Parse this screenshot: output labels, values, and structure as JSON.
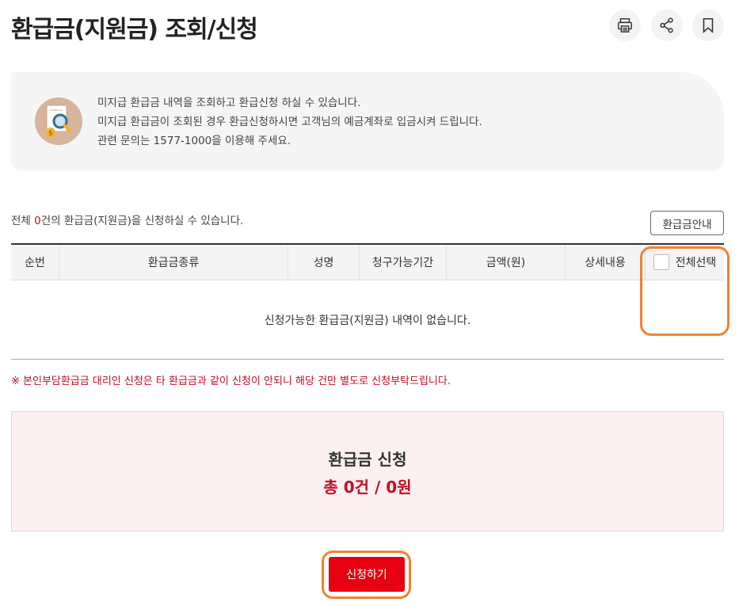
{
  "page": {
    "title": "환급금(지원금) 조회/신청"
  },
  "toolbar": {
    "print_icon": "print-icon",
    "share_icon": "share-icon",
    "bookmark_icon": "bookmark-icon"
  },
  "info": {
    "icon": "document-search-icon",
    "lines": [
      "미지급 환급금 내역을 조회하고 환급신청 하실 수 있습니다.",
      "미지급 환급금이 조회된 경우 환급신청하시면 고객님의 예금계좌로 입금시켜 드립니다.",
      "관련 문의는 1577-1000을 이용해 주세요."
    ]
  },
  "summary": {
    "prefix": "전체 ",
    "count": "0",
    "suffix": "건의 환급금(지원금)을 신청하실 수 있습니다."
  },
  "guide_button": "환급금안내",
  "table": {
    "columns": [
      "순번",
      "환급금종류",
      "성명",
      "청구가능기간",
      "금액(원)",
      "상세내용"
    ],
    "select_all_label": "전체선택",
    "empty_message": "신청가능한 환급금(지원금) 내역이 없습니다."
  },
  "notice": "※ 본인부담환급금 대리인 신청은 타 환급금과 같이 신청이 안되니 해당 건만 별도로 신청부탁드립니다.",
  "apply": {
    "title": "환급금 신청",
    "total": "총 0건 / 0원"
  },
  "submit_button": "신청하기",
  "colors": {
    "accent_red": "#e60012",
    "notice_red": "#c30d23",
    "highlight_orange": "#f2822d"
  }
}
